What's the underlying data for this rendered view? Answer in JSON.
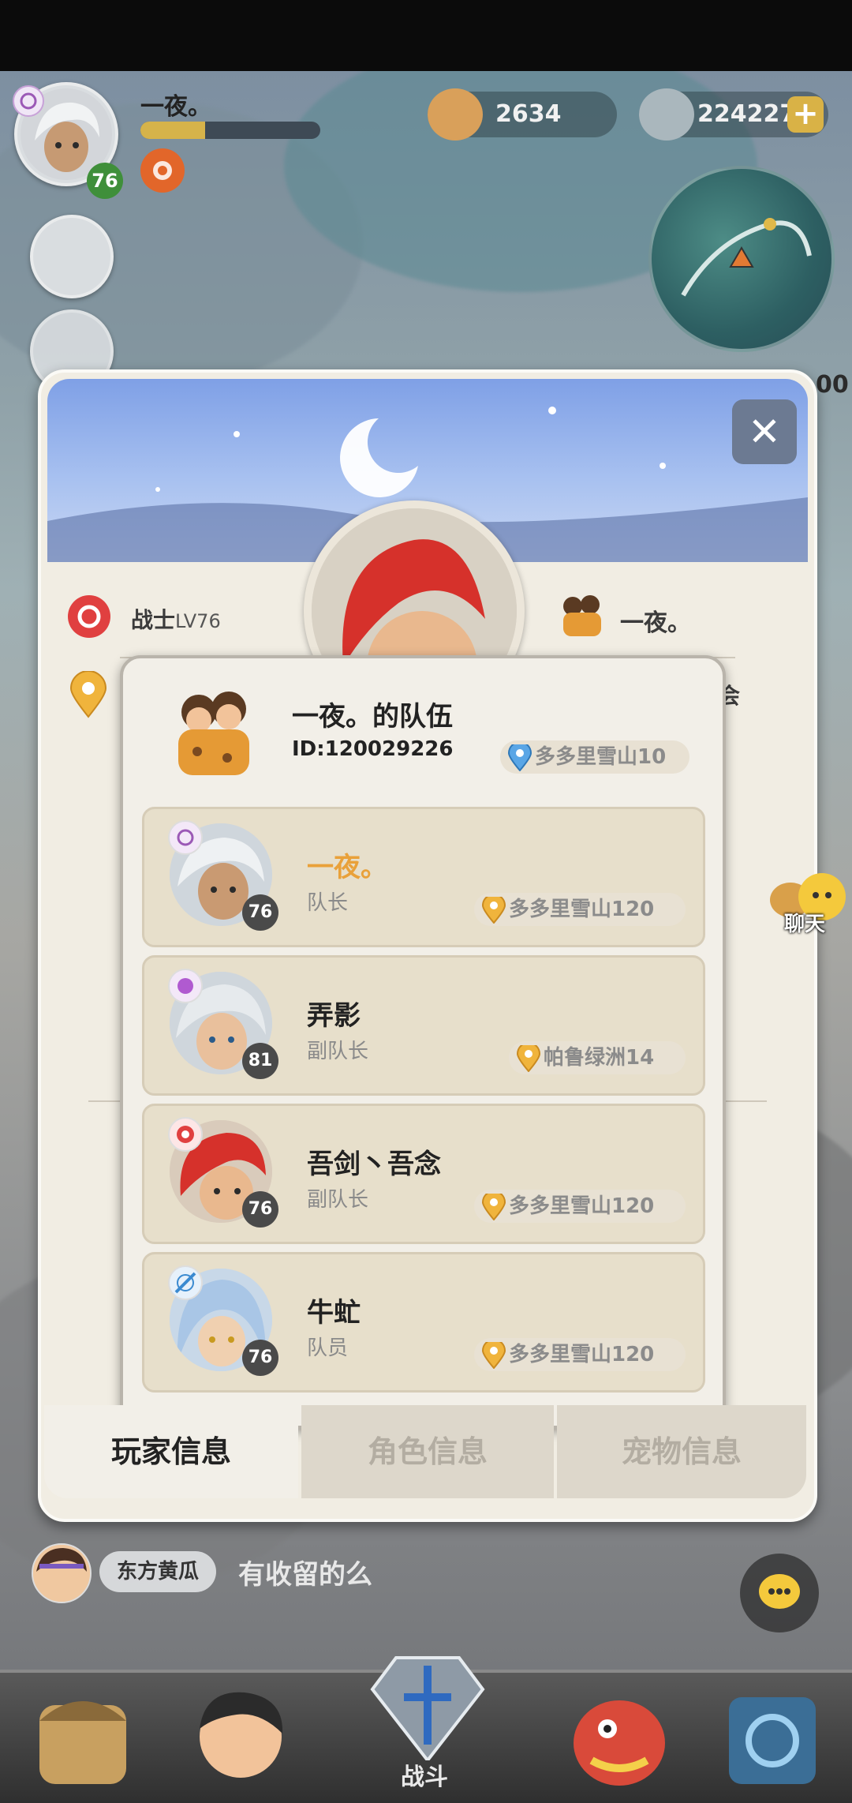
{
  "hud": {
    "player_name": "一夜。",
    "player_level": "76",
    "currency1_value": "2634",
    "currency2_value": "224227",
    "edge_partial_text": "00"
  },
  "profile": {
    "class_label": "战士",
    "class_level": "LV76",
    "owner_name": "一夜。",
    "partial_edge_text": "会"
  },
  "team": {
    "title": "一夜。的队伍",
    "id_text": "ID:120029226",
    "location": "多多里雪山10",
    "members": [
      {
        "name": "一夜。",
        "role": "队长",
        "level": "76",
        "location": "多多里雪山120",
        "name_color": "#e9a13a"
      },
      {
        "name": "弄影",
        "role": "副队长",
        "level": "81",
        "location": "帕鲁绿洲14",
        "name_color": "#222222"
      },
      {
        "name": "吾剑丶吾念",
        "role": "副队长",
        "level": "76",
        "location": "多多里雪山120",
        "name_color": "#222222"
      },
      {
        "name": "牛虻",
        "role": "队员",
        "level": "76",
        "location": "多多里雪山120",
        "name_color": "#222222"
      }
    ]
  },
  "tabs": [
    "玩家信息",
    "角色信息",
    "宠物信息"
  ],
  "chat": {
    "side_label": "聊天",
    "sender": "东方黄瓜",
    "message": "有收留的么"
  },
  "bottom_nav": {
    "center_label": "战斗"
  },
  "colors": {
    "accent_orange": "#e9a13a",
    "panel_bg": "#f1ede3",
    "member_bg": "#e7dfcb"
  }
}
